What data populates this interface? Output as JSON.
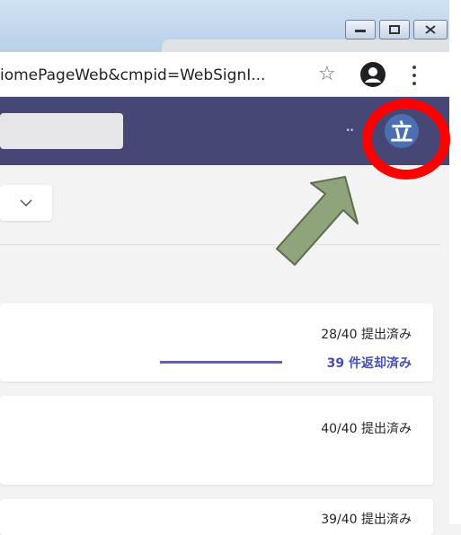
{
  "browser": {
    "url_text": "iomePageWeb&cmpid=WebSignI...",
    "star_icon": "star-icon",
    "profile_icon": "account-icon"
  },
  "app": {
    "avatar_text": "立",
    "more_dots": "··",
    "accent": "#464775"
  },
  "assignments": [
    {
      "submitted": "28/40 提出済み",
      "returned": "39 件返却済み"
    },
    {
      "submitted": "40/40 提出済み"
    },
    {
      "submitted": "39/40 提出済み"
    }
  ],
  "annotation": {
    "highlight_color": "#ff0000",
    "arrow_color": "#8fa47a"
  }
}
